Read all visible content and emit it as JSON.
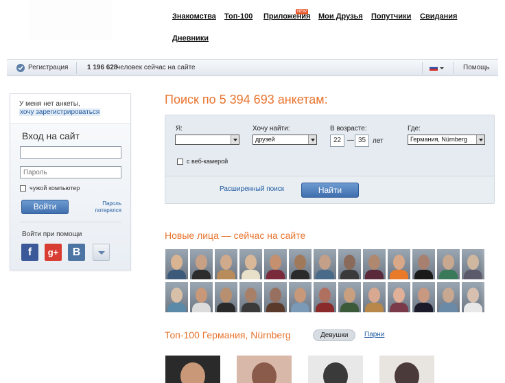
{
  "nav": {
    "items": [
      "Знакомства",
      "Топ-100",
      "Приложения",
      "Мои Друзья",
      "Попутчики",
      "Свидания",
      "Дневники"
    ],
    "new_badge": "NEW"
  },
  "statusbar": {
    "register": "Регистрация",
    "online_count": "1 196 628",
    "online_text": "человек сейчас на сайте",
    "help": "Помощь",
    "flag_icon": "russian-flag-icon"
  },
  "login": {
    "no_profile": "У меня нет анкеты,",
    "want_register": "хочу зарегистрироваться",
    "title": "Вход на сайт",
    "login_value": "",
    "password_placeholder": "Пароль",
    "foreign_pc": "чужой компьютер",
    "submit": "Войти",
    "forgot_line1": "Пароль",
    "forgot_line2": "потерялся",
    "social_title": "Войти при помощи",
    "social": [
      "f",
      "g+",
      "B"
    ]
  },
  "search": {
    "title": "Поиск по 5 394 693 анкетам:",
    "i_label": "Я:",
    "i_value": "",
    "want_label": "Хочу найти:",
    "want_value": "друзей",
    "age_label": "В возрасте:",
    "age_from": "22",
    "age_dash": "—",
    "age_to": "35",
    "age_unit": "лет",
    "where_label": "Где:",
    "where_value": "Германия, Nürnberg",
    "webcam": "с веб-камерой",
    "advanced": "Расширенный поиск",
    "submit": "Найти"
  },
  "new_faces": {
    "title": "Новые лица — сейчас на сайте",
    "row1": [
      [
        "#d9b493",
        "#3d5a7a"
      ],
      [
        "#c8a086",
        "#2c2c2c"
      ],
      [
        "#cfaa8c",
        "#b88b5a"
      ],
      [
        "#d8b898",
        "#e8e0c8"
      ],
      [
        "#c49070",
        "#7a2a3a"
      ],
      [
        "#a0785a",
        "#2a2a2a"
      ],
      [
        "#c4a088",
        "#4a6a8a"
      ],
      [
        "#8a6a5a",
        "#3a3a3a"
      ],
      [
        "#b08870",
        "#5a2a3a"
      ],
      [
        "#d8a888",
        "#e87a2a"
      ],
      [
        "#a88070",
        "#1a1a1a"
      ],
      [
        "#c8a890",
        "#3a7a5a"
      ],
      [
        "#d0b8a0",
        "#5a5a6a"
      ]
    ],
    "row2": [
      [
        "#d8c0a8",
        "#5a8aa8"
      ],
      [
        "#c89878",
        "#dcdcdc"
      ],
      [
        "#b89070",
        "#2a2a2a"
      ],
      [
        "#a88068",
        "#3a3a3a"
      ],
      [
        "#987060",
        "#5a3a2a"
      ],
      [
        "#c8987a",
        "#7a9ab8"
      ],
      [
        "#b07060",
        "#8a2a2a"
      ],
      [
        "#c8a080",
        "#3a5a3a"
      ],
      [
        "#d8a890",
        "#b8884a"
      ],
      [
        "#e0b098",
        "#7a3a4a"
      ],
      [
        "#c89880",
        "#1a1a2a"
      ],
      [
        "#c8a890",
        "#6a8aa8"
      ],
      [
        "#d8c0b0",
        "#e8e8e8"
      ]
    ]
  },
  "top100": {
    "title": "Топ-100 Германия, Nürnberg",
    "girls": "Девушки",
    "boys": "Парни",
    "photos": [
      [
        "#2a2a2a",
        "#c89878"
      ],
      [
        "#d8b8a8",
        "#8a5a4a"
      ],
      [
        "#e8e8e8",
        "#3a3a3a"
      ],
      [
        "#e8e4e0",
        "#4a3a3a"
      ]
    ]
  }
}
